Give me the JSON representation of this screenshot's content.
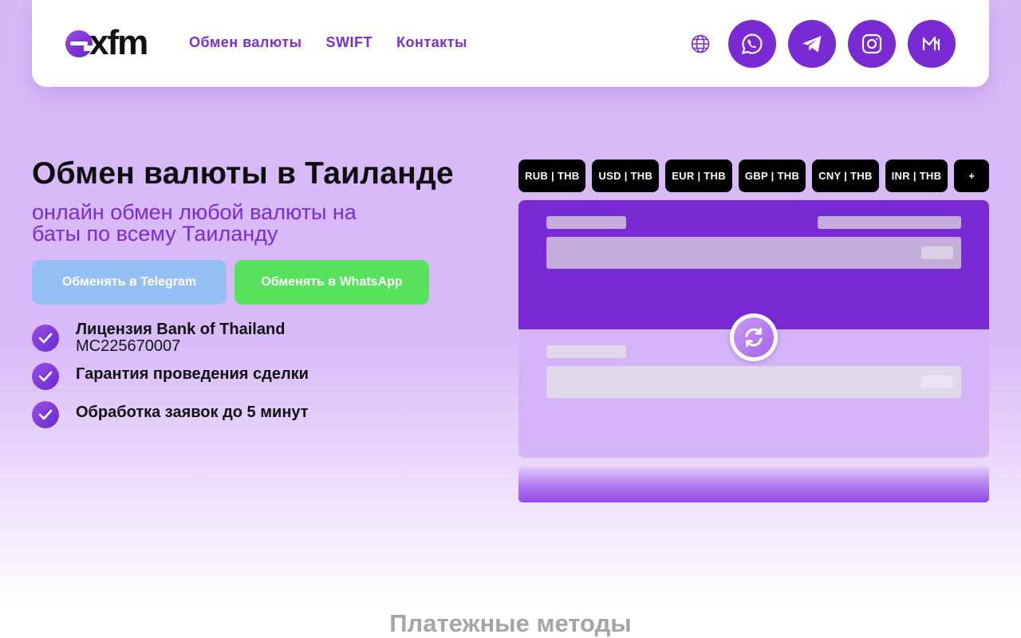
{
  "header": {
    "logo_text": "xfm",
    "nav": [
      {
        "label": "Обмен валюты"
      },
      {
        "label": "SWIFT"
      },
      {
        "label": "Контакты"
      }
    ],
    "icons": {
      "globe": "globe-icon",
      "socials": [
        "whatsapp-icon",
        "telegram-icon",
        "instagram-icon",
        "medium-icon"
      ]
    }
  },
  "hero": {
    "title": "Обмен валюты в Таиланде",
    "subtitle": "онлайн обмен любой валюты на баты по всему Таиланду",
    "buttons": {
      "telegram": "Обменять в Telegram",
      "whatsapp": "Обменять в WhatsApp"
    },
    "features": [
      {
        "title": "Лицензия Bank of Thailand",
        "sub": "MC225670007"
      },
      {
        "title": "Гарантия проведения сделки"
      },
      {
        "title": "Обработка заявок до 5 минут"
      }
    ]
  },
  "exchange": {
    "pairs": [
      "RUB | THB",
      "USD | THB",
      "EUR | THB",
      "GBP | THB",
      "CNY | THB",
      "INR | THB",
      "+"
    ]
  },
  "sections": {
    "payment_methods": "Платежные методы"
  },
  "colors": {
    "brand_purple": "#7a2ad4",
    "telegram_button": "#95c0f5",
    "whatsapp_button": "#57e25d",
    "pair_bg": "#000000"
  }
}
